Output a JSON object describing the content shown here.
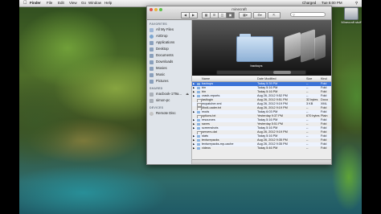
{
  "menubar": {
    "app": "Finder",
    "items": [
      "File",
      "Edit",
      "View",
      "Go",
      "Window",
      "Help"
    ],
    "right": [
      "Charged",
      "Tue 6:00 PM"
    ]
  },
  "desktop_icon": {
    "label": "Minecraft stuff"
  },
  "window": {
    "title": "minecraft",
    "search_placeholder": "Q"
  },
  "sidebar": {
    "favorites_label": "FAVORITES",
    "favorites": [
      "All My Files",
      "AirDrop",
      "Applications",
      "Desktop",
      "Documents",
      "Downloads",
      "Movies",
      "Music",
      "Pictures"
    ],
    "shared_label": "SHARED",
    "shared": [
      "macbook-179a...",
      "simon-pc"
    ],
    "devices_label": "DEVICES",
    "devices": [
      "Remote Disc"
    ]
  },
  "coverflow": {
    "caption": "backups"
  },
  "list": {
    "columns": {
      "name": "Name",
      "date": "Date Modified",
      "size": "Size",
      "kind": "Kind"
    },
    "rows": [
      {
        "name": "backups",
        "date": "Today 5:39 PM",
        "size": "--",
        "kind": "Fold"
      },
      {
        "name": "bin",
        "date": "Today 5:16 PM",
        "size": "--",
        "kind": "Fold"
      },
      {
        "name": "bin",
        "date": "Today 5:16 PM",
        "size": "--",
        "kind": "Fold"
      },
      {
        "name": "crash-reports",
        "date": "Aug 26, 2012 9:52 PM",
        "size": "--",
        "kind": "Fold"
      },
      {
        "name": "lastlogin",
        "date": "Aug 26, 2012 9:51 PM",
        "size": "32 bytes",
        "kind": "Docu"
      },
      {
        "name": "mcpatcher.xml",
        "date": "Aug 26, 2012 9:19 PM",
        "size": "3 KB",
        "kind": "XML"
      },
      {
        "name": "ModLoader.txt",
        "date": "Aug 26, 2012 9:19 PM",
        "size": "--",
        "kind": "Fold"
      },
      {
        "name": "mods",
        "date": "Today 6:03 PM",
        "size": "--",
        "kind": "Fold"
      },
      {
        "name": "options.txt",
        "date": "Yesterday 9:37 PM",
        "size": "670 bytes",
        "kind": "Plain"
      },
      {
        "name": "resources",
        "date": "Today 5:16 PM",
        "size": "--",
        "kind": "Fold"
      },
      {
        "name": "saves",
        "date": "Yesterday 5:51 PM",
        "size": "--",
        "kind": "Fold"
      },
      {
        "name": "screenshots",
        "date": "Today 5:16 PM",
        "size": "--",
        "kind": "Fold"
      },
      {
        "name": "servers.dat",
        "date": "Aug 26, 2012 9:19 PM",
        "size": "--",
        "kind": "Fold"
      },
      {
        "name": "stats",
        "date": "Today 5:16 PM",
        "size": "--",
        "kind": "Fold"
      },
      {
        "name": "texturepacks",
        "date": "Aug 26, 2012 9:35 PM",
        "size": "--",
        "kind": "Fold"
      },
      {
        "name": "texturepacks-mp-cache",
        "date": "Aug 26, 2012 9:35 PM",
        "size": "--",
        "kind": "Fold"
      },
      {
        "name": "videos",
        "date": "Today 5:46 PM",
        "size": "--",
        "kind": "Fold"
      }
    ]
  }
}
